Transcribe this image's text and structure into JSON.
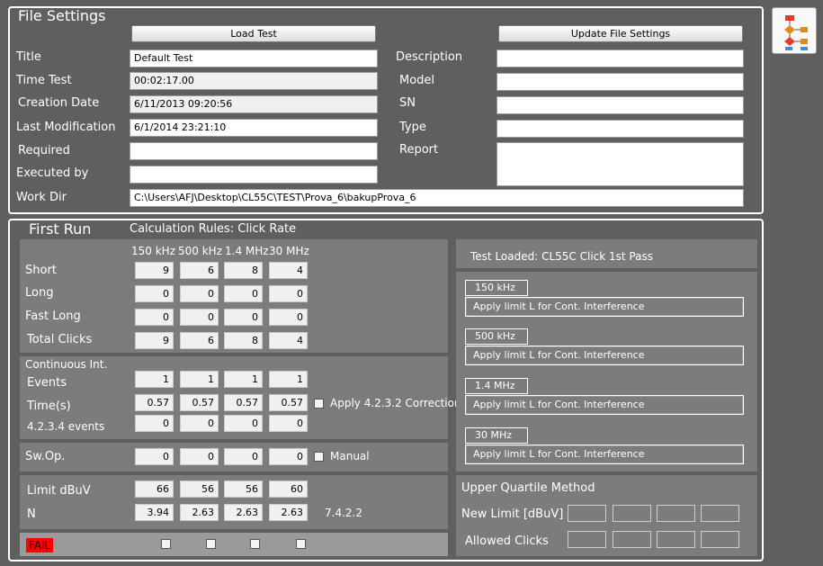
{
  "file_settings": {
    "title": "File Settings",
    "load_button": "Load Test",
    "update_button": "Update File Settings",
    "left_fields": [
      {
        "label": "Title",
        "value": ""
      },
      {
        "label": "Time Test",
        "value": ""
      },
      {
        "label": "Creation Date",
        "value": ""
      },
      {
        "label": "Last Modification",
        "value": ""
      },
      {
        "label": "Required",
        "value": ""
      },
      {
        "label": "Executed by",
        "value": ""
      }
    ],
    "title_value": "Default Test",
    "time_test_value": "00:02:17.00",
    "creation_date_value": "6/11/2013 09:20:56",
    "last_mod_value": "6/1/2014 23:21:10",
    "labels": {
      "title": "Title",
      "time_test": "Time Test",
      "creation_date": "Creation Date",
      "last_modification": "Last Modification",
      "required": "Required",
      "executed_by": "Executed by",
      "work_dir": "Work Dir",
      "description": "Description",
      "model": "Model",
      "sn": "SN",
      "type": "Type",
      "report": "Report"
    },
    "work_dir_value": "C:\\Users\\AFJ\\Desktop\\CL55C\\TEST\\Prova_6\\bakupProva_6"
  },
  "first_run": {
    "title": "First Run",
    "calc_rules": "Calculation Rules: Click Rate",
    "columns": [
      "150 kHz",
      "500 kHz",
      "1.4 MHz",
      "30 MHz"
    ],
    "rows": {
      "short": {
        "label": "Short",
        "values": [
          "9",
          "6",
          "8",
          "4"
        ]
      },
      "long": {
        "label": "Long",
        "values": [
          "0",
          "0",
          "0",
          "0"
        ]
      },
      "fast_long": {
        "label": "Fast Long",
        "values": [
          "0",
          "0",
          "0",
          "0"
        ]
      },
      "total": {
        "label": "Total Clicks",
        "values": [
          "9",
          "6",
          "8",
          "4"
        ]
      }
    },
    "continuous": {
      "title": "Continuous Int.",
      "events": {
        "label": "Events",
        "values": [
          "1",
          "1",
          "1",
          "1"
        ]
      },
      "time": {
        "label": "Time(s)",
        "values": [
          "0.57",
          "0.57",
          "0.57",
          "0.57"
        ]
      },
      "events4234": {
        "label": "4.2.3.4 events",
        "values": [
          "0",
          "0",
          "0",
          "0"
        ]
      },
      "apply_label": "Apply 4.2.3.2 Correction"
    },
    "swop": {
      "label": "Sw.Op.",
      "values": [
        "0",
        "0",
        "0",
        "0"
      ],
      "manual_label": "Manual"
    },
    "limit": {
      "label": "Limit dBuV",
      "values": [
        "66",
        "56",
        "56",
        "60"
      ]
    },
    "n": {
      "label": "N",
      "values": [
        "3.94",
        "2.63",
        "2.63",
        "2.63"
      ],
      "ref": "7.4.2.2"
    },
    "status": "FAIL",
    "status_color": "#ff0000"
  },
  "right_panel": {
    "test_loaded": "Test Loaded:  CL55C Click 1st Pass",
    "limits": [
      {
        "tag": "150 kHz",
        "text": "Apply limit L for Cont. Interference"
      },
      {
        "tag": "500 kHz",
        "text": "Apply limit L for Cont. Interference"
      },
      {
        "tag": "1.4 MHz",
        "text": "Apply limit L for Cont. Interference"
      },
      {
        "tag": "30 MHz",
        "text": "Apply limit L for Cont. Interference"
      }
    ],
    "uq_title": "Upper Quartile Method",
    "new_limit_label": "New Limit [dBuV]",
    "allowed_clicks_label": "Allowed Clicks"
  },
  "toolbar": {
    "flowchart_icon": "flowchart-icon"
  }
}
